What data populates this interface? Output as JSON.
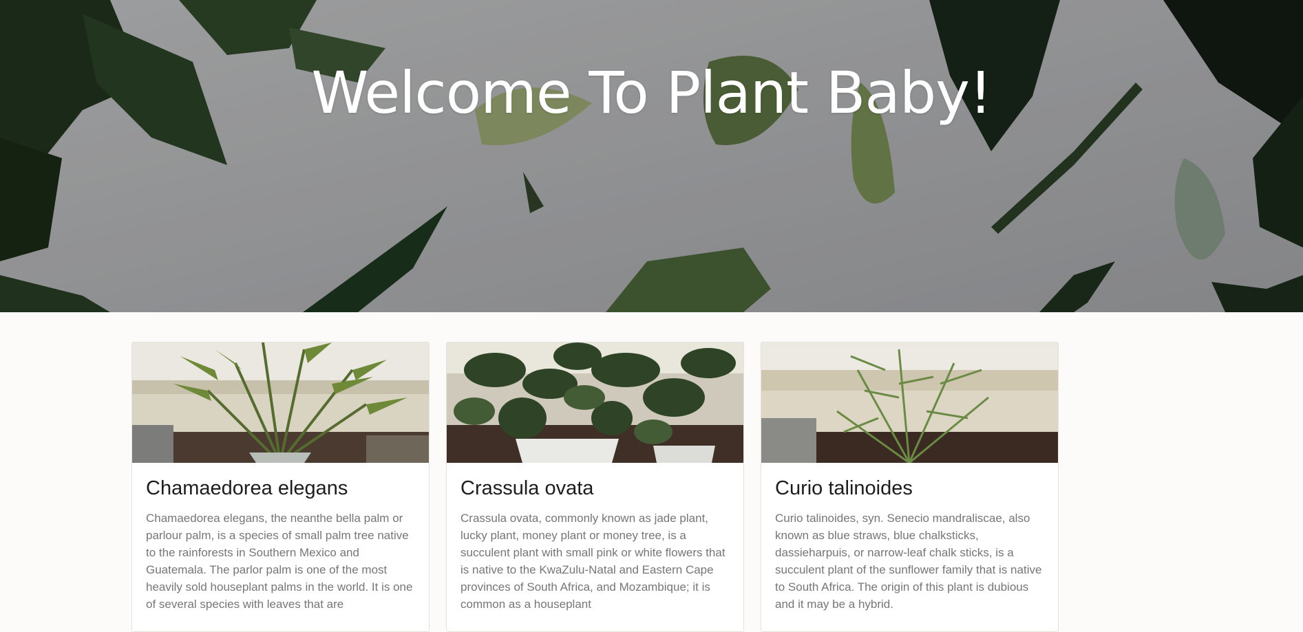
{
  "hero": {
    "title": "Welcome To Plant Baby!",
    "background_image": "leaves-flatlay-photo"
  },
  "cards": [
    {
      "name": "Chamaedorea elegans",
      "image": "parlour-palm-photo",
      "description": "Chamaedorea elegans, the neanthe bella palm or parlour palm, is a species of small palm tree native to the rainforests in Southern Mexico and Guatemala. The parlor palm is one of the most heavily sold houseplant palms in the world. It is one of several species with leaves that are"
    },
    {
      "name": "Crassula ovata",
      "image": "jade-plant-photo",
      "description": "Crassula ovata, commonly known as jade plant, lucky plant, money plant or money tree, is a succulent plant with small pink or white flowers that is native to the KwaZulu-Natal and Eastern Cape provinces of South Africa, and Mozambique; it is common as a houseplant"
    },
    {
      "name": "Curio talinoides",
      "image": "blue-chalksticks-photo",
      "description": "Curio talinoides, syn. Senecio mandraliscae, also known as blue straws, blue chalksticks, dassieharpuis, or narrow-leaf chalk sticks, is a succulent plant of the sunflower family that is native to South Africa. The origin of this plant is dubious and it may be a hybrid."
    }
  ],
  "colors": {
    "page_background": "#fcfbfa",
    "card_background": "#ffffff",
    "title_text": "#1d1d1d",
    "body_text": "#767676",
    "hero_text": "#ffffff"
  }
}
